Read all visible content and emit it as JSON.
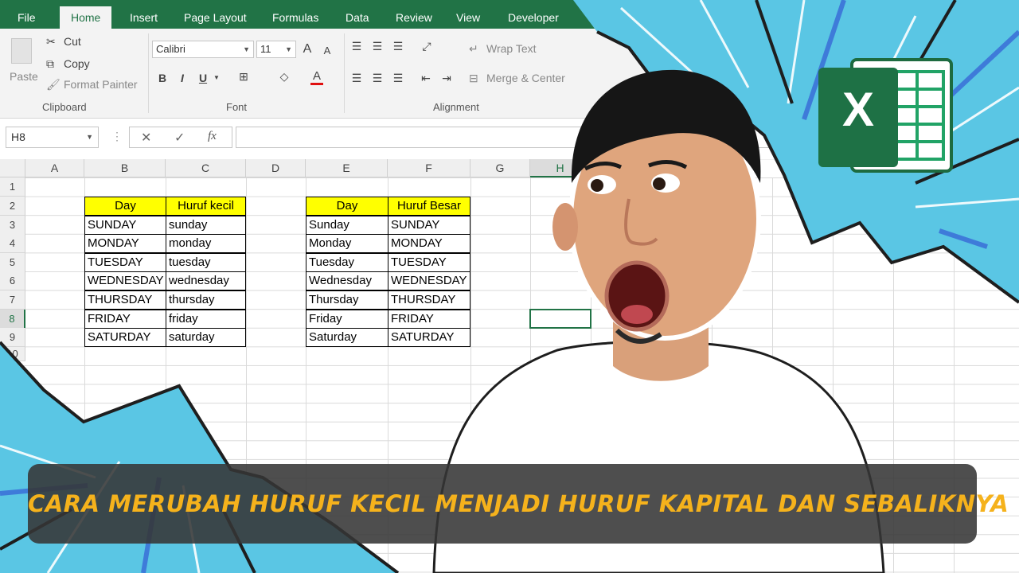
{
  "ribbon": {
    "tabs": [
      "File",
      "Home",
      "Insert",
      "Page Layout",
      "Formulas",
      "Data",
      "Review",
      "View",
      "Developer"
    ],
    "active_tab": "Home",
    "clipboard": {
      "paste": "Paste",
      "cut": "Cut",
      "copy": "Copy",
      "format_painter": "Format Painter",
      "group_label": "Clipboard"
    },
    "font": {
      "family": "Calibri",
      "size": "11",
      "bold": "B",
      "italic": "I",
      "underline": "U",
      "grow": "A",
      "shrink": "A",
      "color_letter": "A",
      "group_label": "Font"
    },
    "alignment": {
      "wrap_text": "Wrap Text",
      "merge_center": "Merge & Center",
      "group_label": "Alignment"
    }
  },
  "formula_bar": {
    "name_box": "H8",
    "cancel_icon": "✕",
    "enter_icon": "✓",
    "fx": "fx",
    "value": ""
  },
  "columns": [
    "A",
    "B",
    "C",
    "D",
    "E",
    "F",
    "G",
    "H"
  ],
  "rows": [
    "1",
    "2",
    "3",
    "4",
    "5",
    "6",
    "7",
    "8",
    "9",
    "10"
  ],
  "table_lower": {
    "headers": [
      "Day",
      "Huruf kecil"
    ],
    "rows": [
      [
        "SUNDAY",
        "sunday"
      ],
      [
        "MONDAY",
        "monday"
      ],
      [
        "TUESDAY",
        "tuesday"
      ],
      [
        "WEDNESDAY",
        "wednesday"
      ],
      [
        "THURSDAY",
        "thursday"
      ],
      [
        "FRIDAY",
        "friday"
      ],
      [
        "SATURDAY",
        "saturday"
      ]
    ]
  },
  "table_upper": {
    "headers": [
      "Day",
      "Huruf Besar"
    ],
    "rows": [
      [
        "Sunday",
        "SUNDAY"
      ],
      [
        "Monday",
        "MONDAY"
      ],
      [
        "Tuesday",
        "TUESDAY"
      ],
      [
        "Wednesday",
        "WEDNESDAY"
      ],
      [
        "Thursday",
        "THURSDAY"
      ],
      [
        "Friday",
        "FRIDAY"
      ],
      [
        "Saturday",
        "SATURDAY"
      ]
    ]
  },
  "excel_logo_letter": "X",
  "banner": {
    "title": "CARA MERUBAH HURUF KECIL MENJADI HURUF KAPITAL DAN SEBALIKNYA"
  },
  "colors": {
    "excel_green": "#217346",
    "header_yellow": "#ffff00",
    "banner_text": "#f5b21c",
    "burst_blue": "#5ac6e4"
  }
}
